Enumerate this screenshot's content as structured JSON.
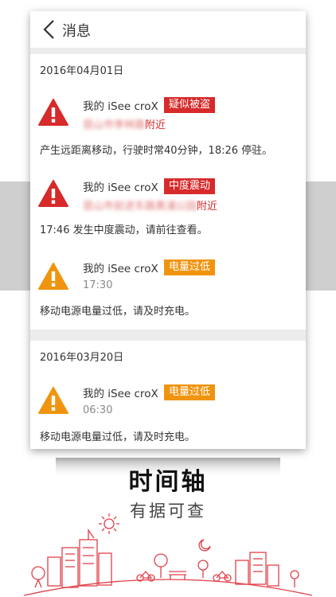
{
  "header": {
    "title": "消息"
  },
  "groups": [
    {
      "date": "2016年04月01日",
      "items": [
        {
          "device": "我的 iSee croX",
          "tag": "疑似被盗",
          "tag_color": "#d72a2a",
          "icon": "warning-red-icon",
          "loc_hidden": "昆山市李林路",
          "loc_suffix": "附近",
          "desc": "产生远距离移动，行驶时常40分钟，18:26 停驻。"
        },
        {
          "device": "我的 iSee croX",
          "tag": "中度震动",
          "tag_color": "#d72a2a",
          "icon": "warning-red-icon",
          "loc_hidden": "昆山市前进东路黄浦公园",
          "loc_suffix": "附近",
          "desc": "17:46 发生中度震动，请前往查看。"
        },
        {
          "device": "我的 iSee croX",
          "tag": "电量过低",
          "tag_color": "#f0940f",
          "icon": "warning-orange-icon",
          "time": "17:30",
          "desc": "移动电源电量过低，请及时充电。"
        }
      ]
    },
    {
      "date": "2016年03月20日",
      "items": [
        {
          "device": "我的 iSee croX",
          "tag": "电量过低",
          "tag_color": "#f0940f",
          "icon": "warning-orange-icon",
          "time": "06:30",
          "desc": "移动电源电量过低，请及时充电。"
        }
      ]
    }
  ],
  "slogan": {
    "main": "时间轴",
    "sub": "有据可查"
  }
}
